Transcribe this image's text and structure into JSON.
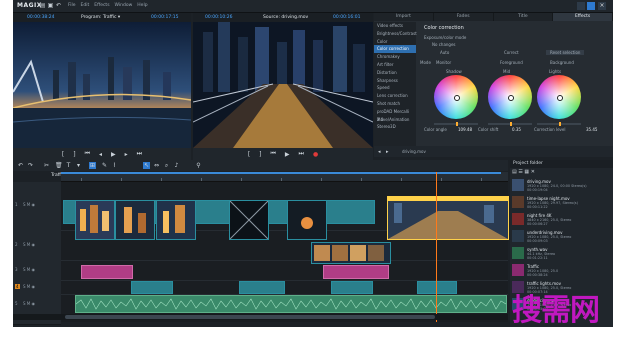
{
  "app": {
    "logo": "MAGIX",
    "menu": [
      "File",
      "Edit",
      "Effects",
      "Window",
      "Help"
    ]
  },
  "program_monitor": {
    "timecode_left": "00:00:38:24",
    "title": "Program: Traffic ▾",
    "timecode_right": "00:00:17:15"
  },
  "source_monitor": {
    "timecode_left": "00:00:10:26",
    "title": "Source: driving.mov",
    "timecode_right": "00:00:16:01"
  },
  "effects_panel": {
    "tabs": [
      "Import",
      "Fades",
      "Title",
      "Effects"
    ],
    "active_tab": 3,
    "list": [
      "Video effects",
      "Brightness/Contrast",
      "Color",
      "Color correction",
      "Chromakey",
      "Art filter",
      "Distortion",
      "Sharpness",
      "Speed",
      "Lens correction",
      "Shot match",
      "proDAD Mercalli 2.0",
      "Move/Animation",
      "Stereo3D"
    ],
    "selected": 3,
    "title": "Color correction",
    "mode_label": "Exposure/color mode",
    "no_changes": "No changes",
    "options": [
      "Auto",
      "Correct",
      "Reset selection"
    ],
    "level_options": [
      "Mode",
      "Monitor",
      "Foreground",
      "Background"
    ],
    "wheels": [
      "Shadow",
      "Mid",
      "Lights"
    ],
    "controls": [
      "Color angle",
      "Color shift",
      "Correction level"
    ],
    "control_values": [
      "109.48",
      "0.35",
      "35.45"
    ],
    "status": "driving.mov"
  },
  "project_bin": {
    "title": "Project folder",
    "items": [
      {
        "name": "driving.mov",
        "meta": "1920 x 1080, 24.0, 00:00 Stereo(s)\n00:00:19:04"
      },
      {
        "name": "time-lapse night.mov",
        "meta": "1920 x 1080, 29.97, Stereo(s)\n00:00:11:22"
      },
      {
        "name": "night fire 4K",
        "meta": "3840 x 2160, 25.0, Stereo\n00:00:06:27"
      },
      {
        "name": "underdriving.mov",
        "meta": "1920 x 1080, 25.0, Stereo\n00:00:09:03"
      },
      {
        "name": "synth.wav",
        "meta": "44.1 kHz, Stereo\n00:01:22:11"
      },
      {
        "name": "Traffic",
        "meta": "1920 x 1080, 25.0\n00:00:38:24"
      },
      {
        "name": "traffic lights.mov",
        "meta": "1920 x 1080, 25.0, Stereo\n00:00:07:14"
      },
      {
        "name": "drone city.mov",
        "meta": "1920 x 1080, 25.0, Stereo\n00:00:15:03"
      }
    ]
  },
  "timeline": {
    "sequence_name": "Traffic",
    "track_labels": [
      "1",
      "2",
      "3",
      "4",
      "5",
      "6"
    ]
  },
  "watermark": "搜需网"
}
